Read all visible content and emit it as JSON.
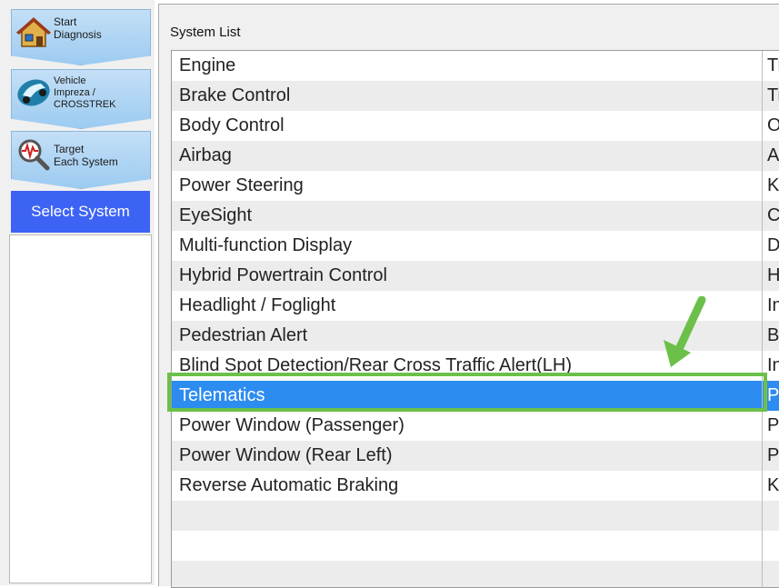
{
  "nav": {
    "steps": [
      {
        "label": "Start\nDiagnosis",
        "icon": "house-icon"
      },
      {
        "label": "Vehicle\nImpreza /\nCROSSTREK",
        "icon": "car-icon"
      },
      {
        "label": "Target\nEach System",
        "icon": "magnifier-waveform-icon"
      }
    ],
    "active_step": "Select System"
  },
  "panel": {
    "title": "System List"
  },
  "systems": [
    {
      "name": "Engine",
      "second": "Tr"
    },
    {
      "name": "Brake Control",
      "second": "Ti"
    },
    {
      "name": "Body Control",
      "second": "O"
    },
    {
      "name": "Airbag",
      "second": "A"
    },
    {
      "name": "Power Steering",
      "second": "K"
    },
    {
      "name": "EyeSight",
      "second": "C"
    },
    {
      "name": "Multi-function Display",
      "second": "D"
    },
    {
      "name": "Hybrid Powertrain Control",
      "second": "H"
    },
    {
      "name": "Headlight / Foglight",
      "second": "In"
    },
    {
      "name": "Pedestrian Alert",
      "second": "B"
    },
    {
      "name": "Blind Spot Detection/Rear Cross Traffic Alert(LH)",
      "second": "In"
    },
    {
      "name": "Telematics",
      "second": "P"
    },
    {
      "name": "Power Window (Passenger)",
      "second": "P"
    },
    {
      "name": "Power Window (Rear Left)",
      "second": "P"
    },
    {
      "name": "Reverse Automatic Braking",
      "second": "K"
    }
  ],
  "selected_index": 11,
  "colors": {
    "accent": "#3d63f5",
    "selection": "#2d8cf0",
    "annotation": "#6cc04a"
  }
}
